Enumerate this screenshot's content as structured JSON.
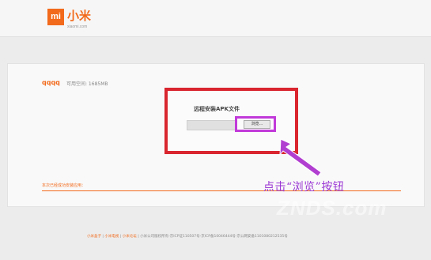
{
  "header": {
    "logo_mark": "mi",
    "brand": "小米",
    "domain": "xiaomi.com"
  },
  "device": {
    "name": "qqqq",
    "space_label": "可用空间: 1685MB"
  },
  "dialog": {
    "title": "远程安装APK文件",
    "browse_label": "浏览..."
  },
  "installed_label": "本次已经成功安装应用：",
  "callout": "点击“浏览”按钮",
  "watermark": "ZNDS.com",
  "footer": {
    "links": [
      "小米盒子",
      "小米电视",
      "小米论坛"
    ],
    "text": "| 小米公司版权所有-京ICP证110507号-京ICP备10046444号-京公网安备1101080212535号"
  },
  "colors": {
    "brand": "#f26a1b",
    "highlight_red": "#d9262f",
    "highlight_purple": "#c13ad9",
    "callout": "#9a37d4"
  }
}
